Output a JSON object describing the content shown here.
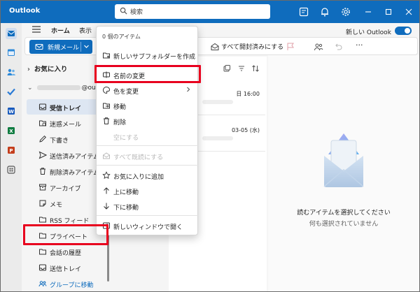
{
  "app": {
    "title": "Outlook"
  },
  "search": {
    "placeholder": "検索"
  },
  "ribbon": {
    "tabs": [
      "ホーム",
      "表示"
    ],
    "new_mail_label": "新規メール",
    "mark_all_read_label": "すべて開封済みにする",
    "new_outlook_label": "新しい Outlook"
  },
  "folders": {
    "favorites_label": "お気に入り",
    "account_suffix": "@ou...",
    "items": [
      {
        "label": "受信トレイ"
      },
      {
        "label": "迷惑メール"
      },
      {
        "label": "下書き"
      },
      {
        "label": "送信済みアイテム"
      },
      {
        "label": "削除済みアイテム"
      },
      {
        "label": "アーカイブ"
      },
      {
        "label": "メモ"
      },
      {
        "label": "RSS フィード"
      },
      {
        "label": "プライベート"
      },
      {
        "label": "会話の履歴"
      },
      {
        "label": "送信トレイ"
      },
      {
        "label": "グループに移動"
      }
    ],
    "more_label": "···"
  },
  "messages": [
    {
      "date": "日 16:00"
    },
    {
      "date": "03-05 (水)"
    }
  ],
  "reading_pane": {
    "title": "読むアイテムを選択してください",
    "subtitle": "何も選択されていません"
  },
  "context_menu": {
    "header": "0 個のアイテム",
    "items": [
      {
        "label": "新しいサブフォルダーを作成",
        "icon": "new-folder-icon",
        "disabled": false
      },
      {
        "label": "名前の変更",
        "icon": "rename-icon",
        "disabled": false
      },
      {
        "label": "色を変更",
        "icon": "palette-icon",
        "disabled": false,
        "submenu": true
      },
      {
        "label": "移動",
        "icon": "move-folder-icon",
        "disabled": false
      },
      {
        "label": "削除",
        "icon": "trash-icon",
        "disabled": false
      },
      {
        "label": "空にする",
        "icon": "",
        "disabled": true
      },
      {
        "label": "すべて既読にする",
        "icon": "mail-open-icon",
        "disabled": true
      },
      {
        "label": "お気に入りに追加",
        "icon": "star-icon",
        "disabled": false
      },
      {
        "label": "上に移動",
        "icon": "arrow-up-icon",
        "disabled": false
      },
      {
        "label": "下に移動",
        "icon": "arrow-down-icon",
        "disabled": false
      },
      {
        "label": "新しいウィンドウで開く",
        "icon": "open-window-icon",
        "disabled": false
      }
    ]
  },
  "colors": {
    "brand": "#0f6cbd",
    "highlight": "#e8001e",
    "selected_folder_bg": "#dde6f2"
  }
}
